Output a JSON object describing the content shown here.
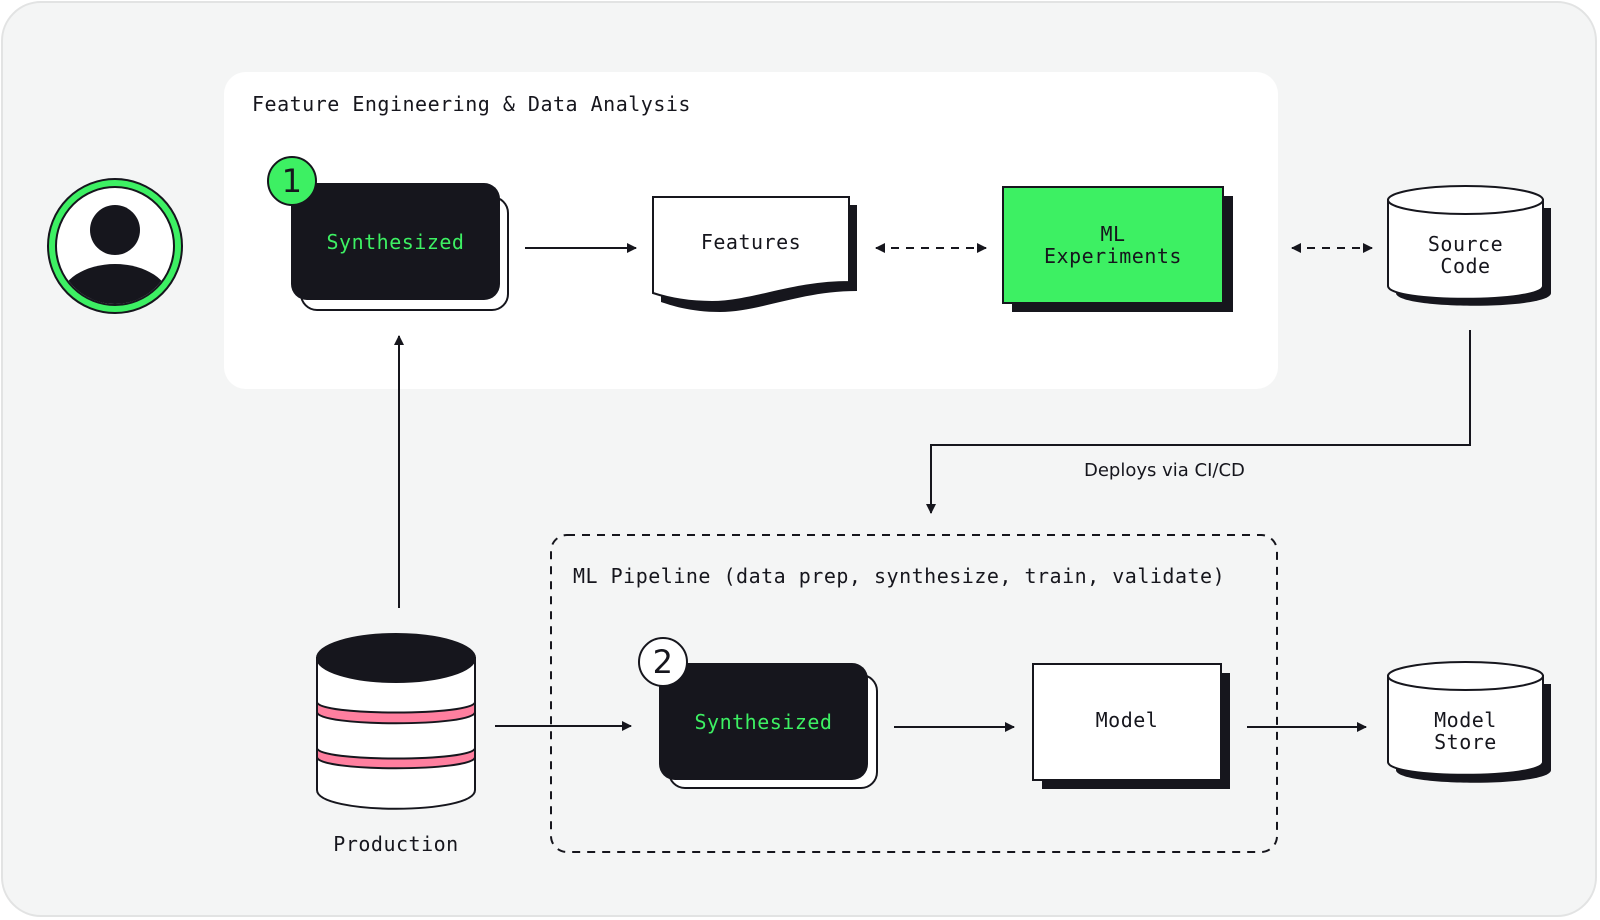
{
  "diagram": {
    "colors": {
      "background": "#f4f5f5",
      "panel": "#ffffff",
      "ink": "#16161d",
      "accent_green": "#3df063",
      "accent_pink": "#ff7f9f"
    },
    "user": {
      "icon": "user-avatar-icon"
    },
    "feature_panel": {
      "title": "Feature Engineering & Data Analysis"
    },
    "pipeline_panel": {
      "title": "ML Pipeline (data prep, synthesize, train, validate)"
    },
    "nodes": {
      "synth1": {
        "label": "Synthesized",
        "badge": "1"
      },
      "features": {
        "label": "Features"
      },
      "ml_experiments": {
        "line1": "ML",
        "line2": "Experiments"
      },
      "source_code": {
        "line1": "Source",
        "line2": "Code"
      },
      "production": {
        "label": "Production"
      },
      "synth2": {
        "label": "Synthesized",
        "badge": "2"
      },
      "model": {
        "label": "Model"
      },
      "model_store": {
        "line1": "Model",
        "line2": "Store"
      }
    },
    "edges": [
      {
        "from": "synth1",
        "to": "features",
        "style": "solid",
        "direction": "forward"
      },
      {
        "from": "features",
        "to": "ml_experiments",
        "style": "dashed",
        "direction": "both"
      },
      {
        "from": "ml_experiments",
        "to": "source_code",
        "style": "dashed",
        "direction": "both"
      },
      {
        "from": "source_code",
        "to": "ml_pipeline",
        "style": "solid",
        "direction": "forward",
        "label": "Deploys via CI/CD"
      },
      {
        "from": "production",
        "to": "synth1",
        "style": "solid",
        "direction": "forward"
      },
      {
        "from": "production",
        "to": "synth2",
        "style": "solid",
        "direction": "forward"
      },
      {
        "from": "synth2",
        "to": "model",
        "style": "solid",
        "direction": "forward"
      },
      {
        "from": "model",
        "to": "model_store",
        "style": "solid",
        "direction": "forward"
      }
    ]
  }
}
